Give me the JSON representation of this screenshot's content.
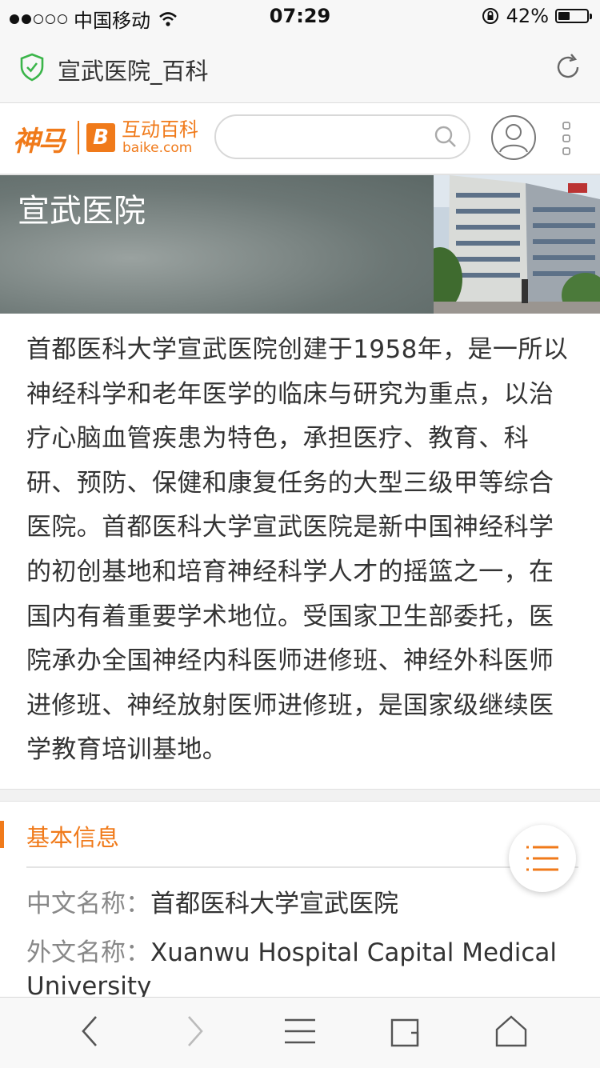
{
  "status_bar": {
    "carrier": "中国移动",
    "time": "07:29",
    "battery_percent": "42%",
    "battery_level": 0.42,
    "signal_dots_filled": 2,
    "signal_dots_total": 5
  },
  "address_bar": {
    "title": "宣武医院_百科",
    "icons": [
      "shield-check-icon",
      "refresh-icon"
    ]
  },
  "site_header": {
    "logo_shenma": "神马",
    "logo_b": "B",
    "logo_hudong": "互动百科",
    "logo_domain": "baike.com",
    "search_placeholder": "",
    "icons": [
      "search-icon",
      "user-avatar-icon",
      "more-vertical-icon"
    ]
  },
  "hero": {
    "title": "宣武医院"
  },
  "summary": {
    "text": "首都医科大学宣武医院创建于1958年，是一所以神经科学和老年医学的临床与研究为重点，以治疗心脑血管疾患为特色，承担医疗、教育、科研、预防、保健和康复任务的大型三级甲等综合医院。首都医科大学宣武医院是新中国神经科学的初创基地和培育神经科学人才的摇篮之一，在国内有着重要学术地位。受国家卫生部委托，医院承办全国神经内科医师进修班、神经外科医师进修班、神经放射医师进修班，是国家级继续医学教育培训基地。"
  },
  "basic_info": {
    "title": "基本信息",
    "rows": [
      {
        "label": "中文名称：",
        "value": "首都医科大学宣武医院"
      },
      {
        "label": "外文名称：",
        "value": "Xuanwu Hospital Capital Medical University"
      }
    ]
  },
  "toolbar": {
    "icons": [
      "back-arrow-icon",
      "forward-arrow-icon",
      "menu-icon",
      "tabs-icon",
      "home-icon"
    ]
  },
  "colors": {
    "accent": "#f07a1a",
    "shield": "#3bb54a"
  }
}
